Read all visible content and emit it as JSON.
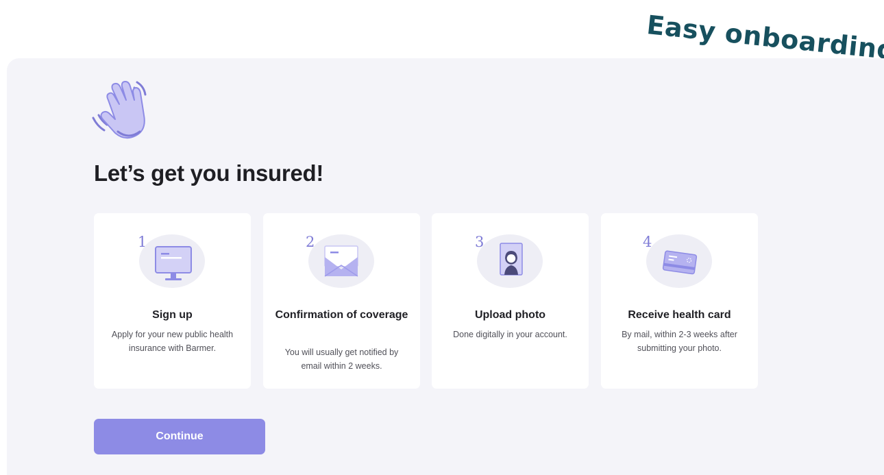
{
  "annotation": {
    "label": "Easy onboarding"
  },
  "page": {
    "title": "Let’s get you insured!"
  },
  "steps": [
    {
      "number": "1",
      "icon": "monitor-icon",
      "title": "Sign up",
      "description": "Apply for your new public health insurance with Barmer."
    },
    {
      "number": "2",
      "icon": "envelope-icon",
      "title": "Confirmation of coverage",
      "description": "You will usually get notified by email within 2 weeks."
    },
    {
      "number": "3",
      "icon": "photo-id-icon",
      "title": "Upload photo",
      "description": "Done digitally in your account."
    },
    {
      "number": "4",
      "icon": "health-card-icon",
      "title": "Receive health card",
      "description": "By mail, within 2-3 weeks after submitting your photo."
    }
  ],
  "actions": {
    "continue_label": "Continue"
  },
  "colors": {
    "accent": "#8d8be5",
    "annotation": "#17505e",
    "arrow": "#f5b34c",
    "panel": "#f4f4f9"
  }
}
